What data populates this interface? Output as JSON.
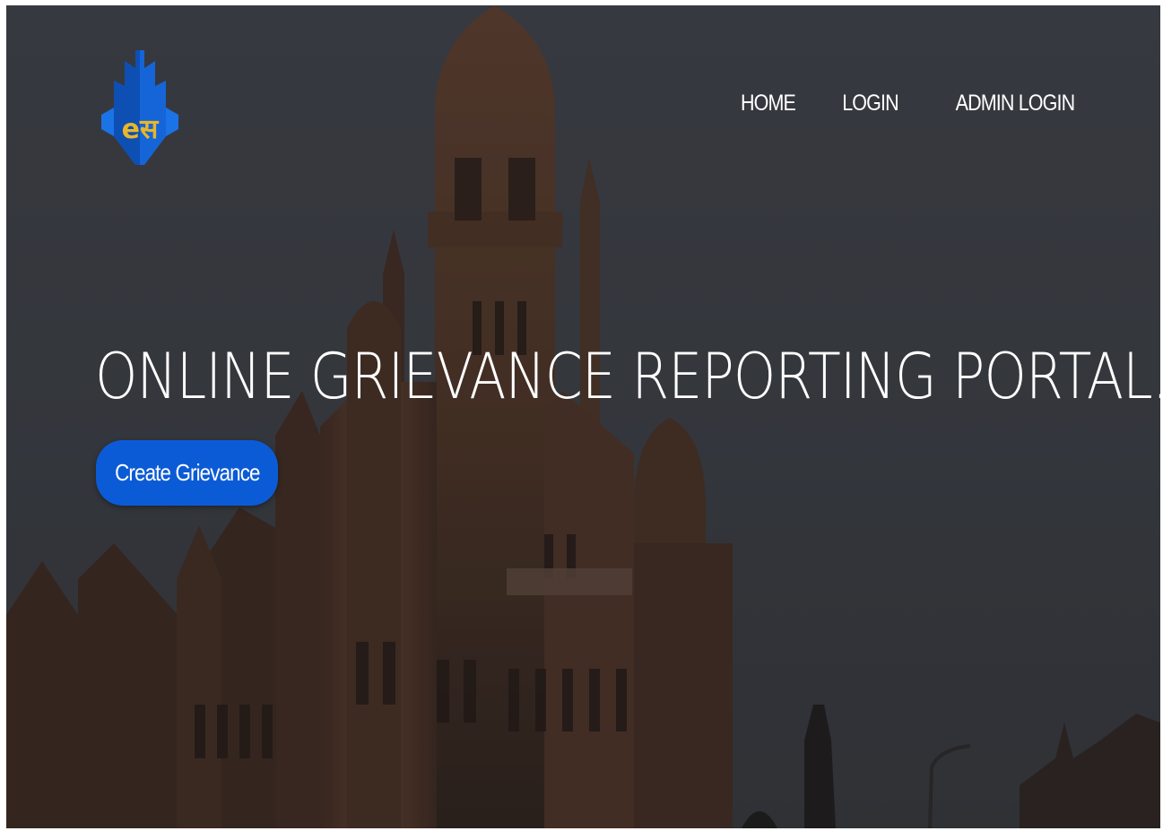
{
  "nav": {
    "items": [
      {
        "label": "HOME"
      },
      {
        "label": "LOGIN"
      },
      {
        "label": "ADMIN LOGIN"
      }
    ]
  },
  "logo": {
    "text": "eस"
  },
  "hero": {
    "title": "ONLINE GRIEVANCE REPORTING PORTAL.",
    "cta_label": "Create Grievance"
  },
  "colors": {
    "accent": "#0b5bd6",
    "logo_blue": "#1565d8",
    "logo_gold": "#e8b62a",
    "background": "#3d4047"
  }
}
